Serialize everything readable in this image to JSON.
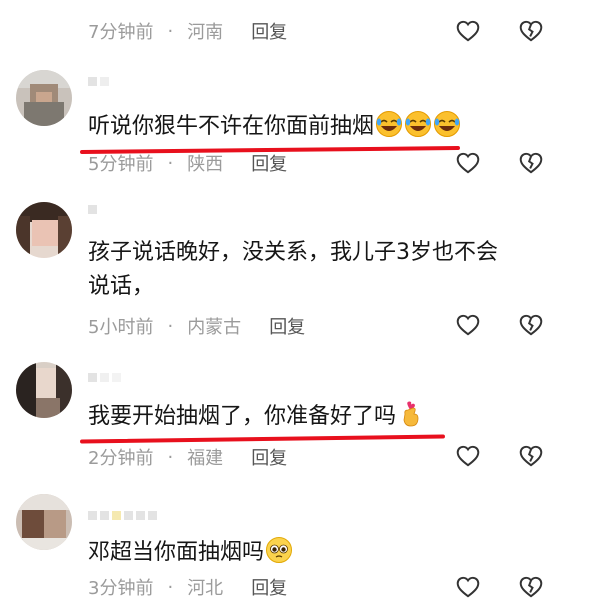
{
  "comments": [
    {
      "text": "",
      "time": "7分钟前",
      "location": "河南",
      "reply_label": "回复",
      "emojis": []
    },
    {
      "text": "听说你狠牛不许在你面前抽烟",
      "time": "5分钟前",
      "location": "陕西",
      "reply_label": "回复",
      "emojis": [
        "rofl-emoji",
        "rofl-emoji",
        "rofl-emoji"
      ]
    },
    {
      "text_line1": "孩子说话晚好，没关系，我儿子3岁也不会",
      "text_line2": "说话，",
      "time": "5小时前",
      "location": "内蒙古",
      "reply_label": "回复",
      "emojis": []
    },
    {
      "text": "我要开始抽烟了，你准备好了吗",
      "time": "2分钟前",
      "location": "福建",
      "reply_label": "回复",
      "emojis": [
        "finger-heart-emoji"
      ]
    },
    {
      "text": "邓超当你面抽烟吗",
      "time": "3分钟前",
      "location": "河北",
      "reply_label": "回复",
      "emojis": [
        "pleading-emoji"
      ]
    }
  ],
  "separator": "·",
  "icons": {
    "like": "heart-outline-icon",
    "dislike": "broken-heart-icon"
  },
  "colors": {
    "underline": "#e8101d",
    "meta_text": "#9b9b9b",
    "body_text": "#161616"
  }
}
